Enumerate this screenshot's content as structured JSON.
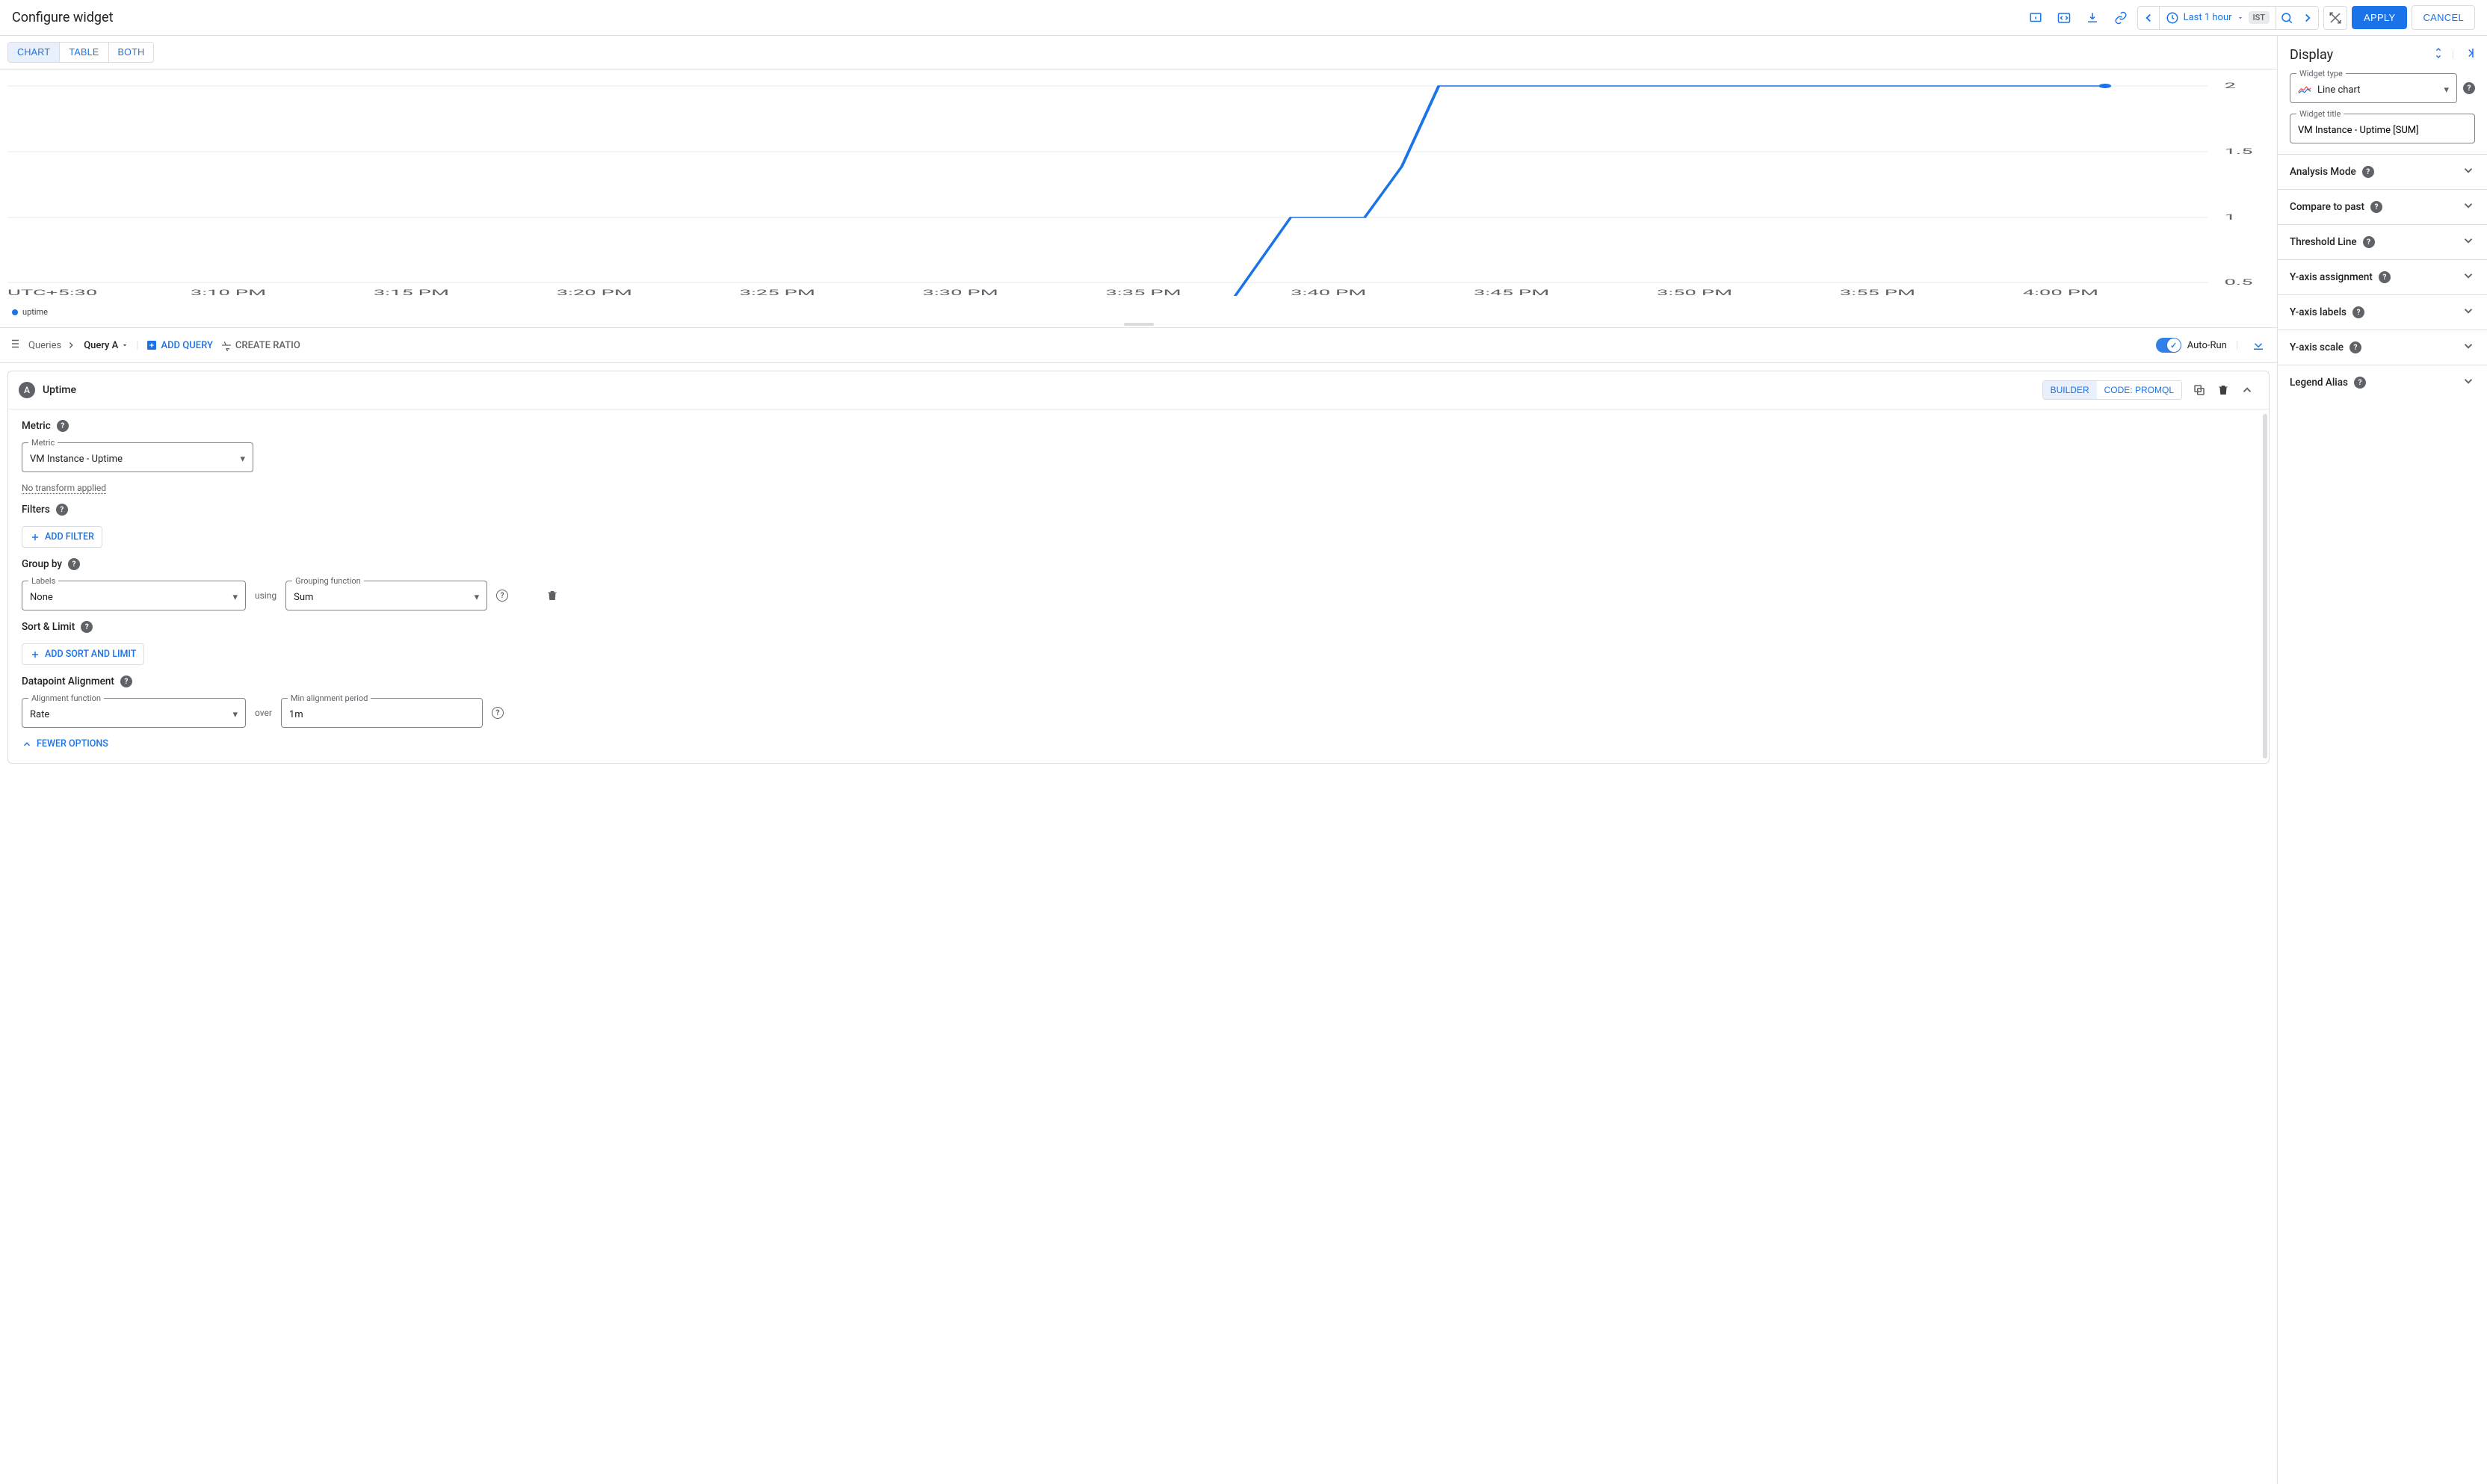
{
  "header": {
    "title": "Configure widget",
    "time_range": "Last 1 hour",
    "timezone": "IST",
    "apply": "APPLY",
    "cancel": "CANCEL"
  },
  "view_tabs": {
    "chart": "CHART",
    "table": "TABLE",
    "both": "BOTH"
  },
  "chart_data": {
    "type": "line",
    "timezone_label": "UTC+5:30",
    "x_times": [
      "3:10 PM",
      "3:15 PM",
      "3:20 PM",
      "3:25 PM",
      "3:30 PM",
      "3:35 PM",
      "3:40 PM",
      "3:45 PM",
      "3:50 PM",
      "3:55 PM",
      "4:00 PM"
    ],
    "y_ticks": [
      0.5,
      1,
      1.5,
      2
    ],
    "ylim": [
      0.4,
      2.05
    ],
    "series": [
      {
        "name": "uptime",
        "color": "#1a73e8",
        "points": [
          {
            "x": "3:38 PM",
            "y": 0.4
          },
          {
            "x": "3:40 PM",
            "y": 1.0
          },
          {
            "x": "3:42 PM",
            "y": 1.0
          },
          {
            "x": "3:43 PM",
            "y": 1.5
          },
          {
            "x": "3:44 PM",
            "y": 2.0
          },
          {
            "x": "3:59 PM",
            "y": 2.0
          }
        ]
      }
    ],
    "legend": [
      "uptime"
    ]
  },
  "query_bar": {
    "queries_label": "Queries",
    "current_query": "Query A",
    "add_query": "ADD QUERY",
    "create_ratio": "CREATE RATIO",
    "auto_run": "Auto-Run"
  },
  "query_card": {
    "badge": "A",
    "title": "Uptime",
    "builder_tab": "BUILDER",
    "code_tab": "CODE: PROMQL",
    "metric": {
      "section": "Metric",
      "field_label": "Metric",
      "value": "VM Instance - Uptime",
      "no_transform": "No transform applied"
    },
    "filters": {
      "section": "Filters",
      "add": "ADD FILTER"
    },
    "groupby": {
      "section": "Group by",
      "labels_label": "Labels",
      "labels_value": "None",
      "using": "using",
      "grouping_fn_label": "Grouping function",
      "grouping_fn_value": "Sum"
    },
    "sort": {
      "section": "Sort & Limit",
      "add": "ADD SORT AND LIMIT"
    },
    "alignment": {
      "section": "Datapoint Alignment",
      "fn_label": "Alignment function",
      "fn_value": "Rate",
      "over": "over",
      "period_label": "Min alignment period",
      "period_value": "1m"
    },
    "fewer_options": "FEWER OPTIONS"
  },
  "display": {
    "title": "Display",
    "widget_type_label": "Widget type",
    "widget_type_value": "Line chart",
    "widget_title_label": "Widget title",
    "widget_title_value": "VM Instance - Uptime [SUM]",
    "sections": [
      "Analysis Mode",
      "Compare to past",
      "Threshold Line",
      "Y-axis assignment",
      "Y-axis labels",
      "Y-axis scale",
      "Legend Alias"
    ]
  }
}
